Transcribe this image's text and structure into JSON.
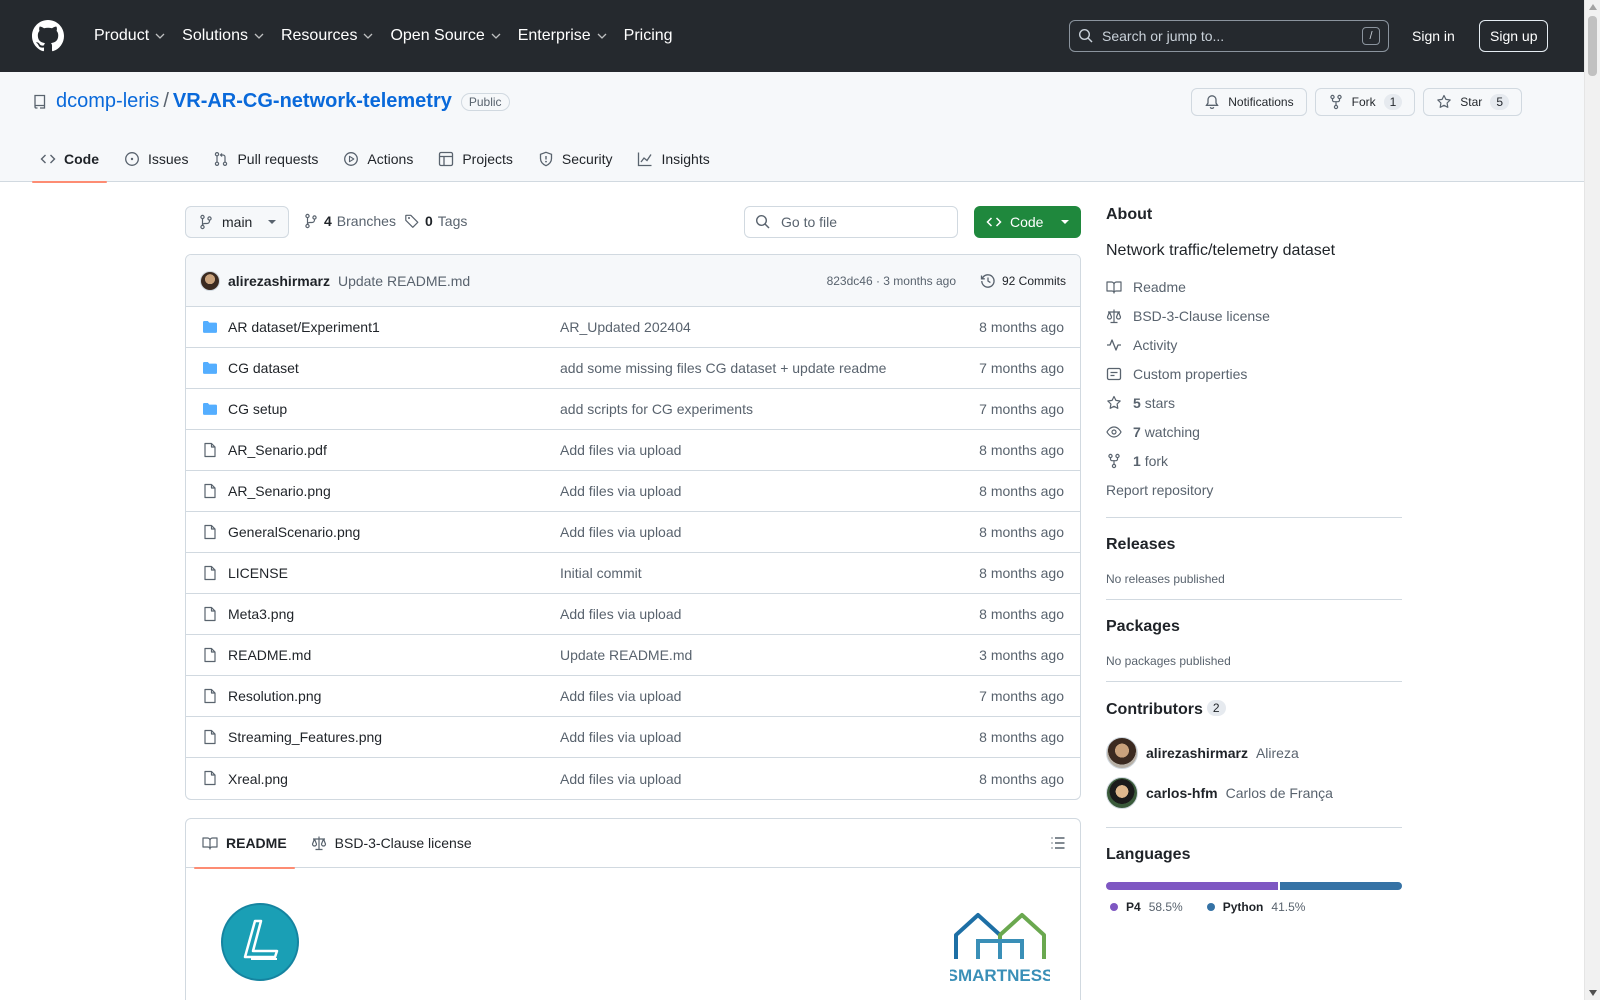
{
  "header": {
    "nav": [
      {
        "label": "Product",
        "dropdown": true
      },
      {
        "label": "Solutions",
        "dropdown": true
      },
      {
        "label": "Resources",
        "dropdown": true
      },
      {
        "label": "Open Source",
        "dropdown": true
      },
      {
        "label": "Enterprise",
        "dropdown": true
      },
      {
        "label": "Pricing",
        "dropdown": false
      }
    ],
    "search_placeholder": "Search or jump to...",
    "search_shortcut": "/",
    "sign_in": "Sign in",
    "sign_up": "Sign up"
  },
  "repo": {
    "owner": "dcomp-leris",
    "separator": "/",
    "name": "VR-AR-CG-network-telemetry",
    "visibility": "Public",
    "notifications_label": "Notifications",
    "fork_label": "Fork",
    "fork_count": "1",
    "star_label": "Star",
    "star_count": "5"
  },
  "tabs": [
    {
      "label": "Code",
      "icon": "code-icon",
      "active": true
    },
    {
      "label": "Issues",
      "icon": "issue-icon",
      "active": false
    },
    {
      "label": "Pull requests",
      "icon": "pull-request-icon",
      "active": false
    },
    {
      "label": "Actions",
      "icon": "play-icon",
      "active": false
    },
    {
      "label": "Projects",
      "icon": "table-icon",
      "active": false
    },
    {
      "label": "Security",
      "icon": "shield-icon",
      "active": false
    },
    {
      "label": "Insights",
      "icon": "graph-icon",
      "active": false
    }
  ],
  "toolbar": {
    "branch": "main",
    "branches_count": "4",
    "branches_label": "Branches",
    "tags_count": "0",
    "tags_label": "Tags",
    "goto_placeholder": "Go to file",
    "code_button": "Code"
  },
  "latest_commit": {
    "author": "alirezashirmarz",
    "message": "Update README.md",
    "meta": "823dc46 · 3 months ago",
    "commits_label": "92 Commits"
  },
  "files": [
    {
      "type": "folder",
      "name": "AR dataset/Experiment1",
      "message": "AR_Updated 202404",
      "age": "8 months ago"
    },
    {
      "type": "folder",
      "name": "CG dataset",
      "message": "add some missing files CG dataset + update readme",
      "age": "7 months ago"
    },
    {
      "type": "folder",
      "name": "CG setup",
      "message": "add scripts for CG experiments",
      "age": "7 months ago"
    },
    {
      "type": "file",
      "name": "AR_Senario.pdf",
      "message": "Add files via upload",
      "age": "8 months ago"
    },
    {
      "type": "file",
      "name": "AR_Senario.png",
      "message": "Add files via upload",
      "age": "8 months ago"
    },
    {
      "type": "file",
      "name": "GeneralScenario.png",
      "message": "Add files via upload",
      "age": "8 months ago"
    },
    {
      "type": "file",
      "name": "LICENSE",
      "message": "Initial commit",
      "age": "8 months ago"
    },
    {
      "type": "file",
      "name": "Meta3.png",
      "message": "Add files via upload",
      "age": "8 months ago"
    },
    {
      "type": "file",
      "name": "README.md",
      "message": "Update README.md",
      "age": "3 months ago"
    },
    {
      "type": "file",
      "name": "Resolution.png",
      "message": "Add files via upload",
      "age": "7 months ago"
    },
    {
      "type": "file",
      "name": "Streaming_Features.png",
      "message": "Add files via upload",
      "age": "8 months ago"
    },
    {
      "type": "file",
      "name": "Xreal.png",
      "message": "Add files via upload",
      "age": "8 months ago"
    }
  ],
  "readme": {
    "tab_readme": "README",
    "tab_license": "BSD-3-Clause license",
    "logo_right_text": "SMARTNESS"
  },
  "sidebar": {
    "about_title": "About",
    "description": "Network traffic/telemetry dataset",
    "readme": "Readme",
    "license": "BSD-3-Clause license",
    "activity": "Activity",
    "custom_properties": "Custom properties",
    "stars_count": "5",
    "stars_label": "stars",
    "watching_count": "7",
    "watching_label": "watching",
    "fork_count": "1",
    "fork_label": "fork",
    "report": "Report repository",
    "releases_title": "Releases",
    "releases_empty": "No releases published",
    "packages_title": "Packages",
    "packages_empty": "No packages published",
    "contributors_title": "Contributors",
    "contributors_count": "2",
    "contributors": [
      {
        "login": "alirezashirmarz",
        "name": "Alireza"
      },
      {
        "login": "carlos-hfm",
        "name": "Carlos de França"
      }
    ],
    "languages_title": "Languages",
    "languages": [
      {
        "name": "P4",
        "percent": "58.5%",
        "value": 58.5,
        "color": "#7e57c2"
      },
      {
        "name": "Python",
        "percent": "41.5%",
        "value": 41.5,
        "color": "#3572a5"
      }
    ]
  },
  "colors": {
    "header_bg": "#25292e",
    "link": "#0969da",
    "code_button": "#1f883d",
    "tab_underline": "#fd8c73",
    "folder": "#54aeff"
  }
}
